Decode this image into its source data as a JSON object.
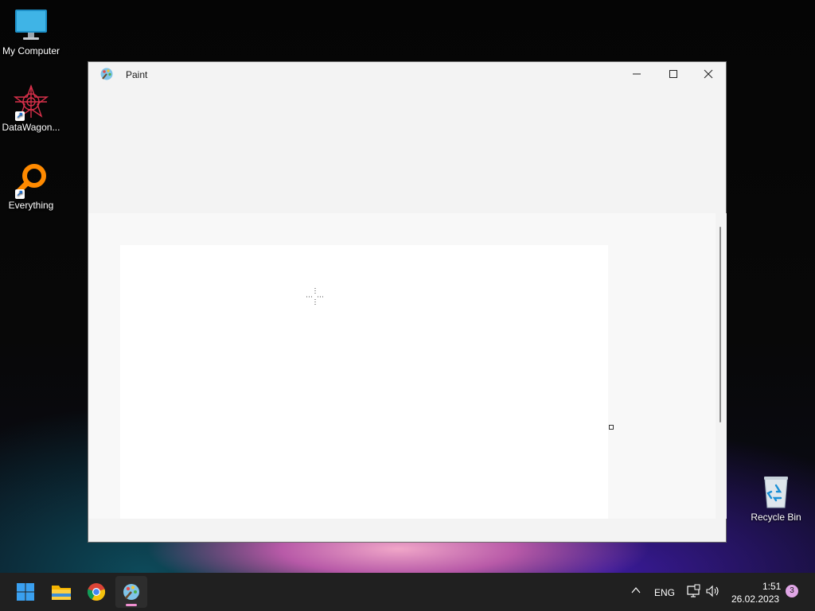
{
  "desktop": {
    "icons": [
      {
        "label": "My Computer",
        "icon": "monitor-icon"
      },
      {
        "label": "DataWagon...",
        "icon": "datawagon-icon",
        "shortcut": true
      },
      {
        "label": "Everything",
        "icon": "magnifier-icon",
        "shortcut": true
      },
      {
        "label": "Recycle Bin",
        "icon": "recycle-bin-icon"
      }
    ]
  },
  "window": {
    "title": "Paint",
    "icon": "paint-icon",
    "controls": [
      "minimize-icon",
      "maximize-icon",
      "close-icon"
    ]
  },
  "taskbar": {
    "apps": [
      {
        "name": "Start",
        "icon": "windows-start-icon"
      },
      {
        "name": "File Explorer",
        "icon": "folder-icon"
      },
      {
        "name": "Google Chrome",
        "icon": "chrome-icon"
      },
      {
        "name": "Paint",
        "icon": "paint-icon",
        "active": true
      }
    ],
    "tray": {
      "language": "ENG",
      "time": "1:51",
      "date": "26.02.2023",
      "notifications": "3"
    }
  },
  "colors": {
    "taskbar": "#202020",
    "window_bg": "#f3f3f3",
    "canvas": "#ffffff",
    "active_indicator": "#f08fd0"
  }
}
